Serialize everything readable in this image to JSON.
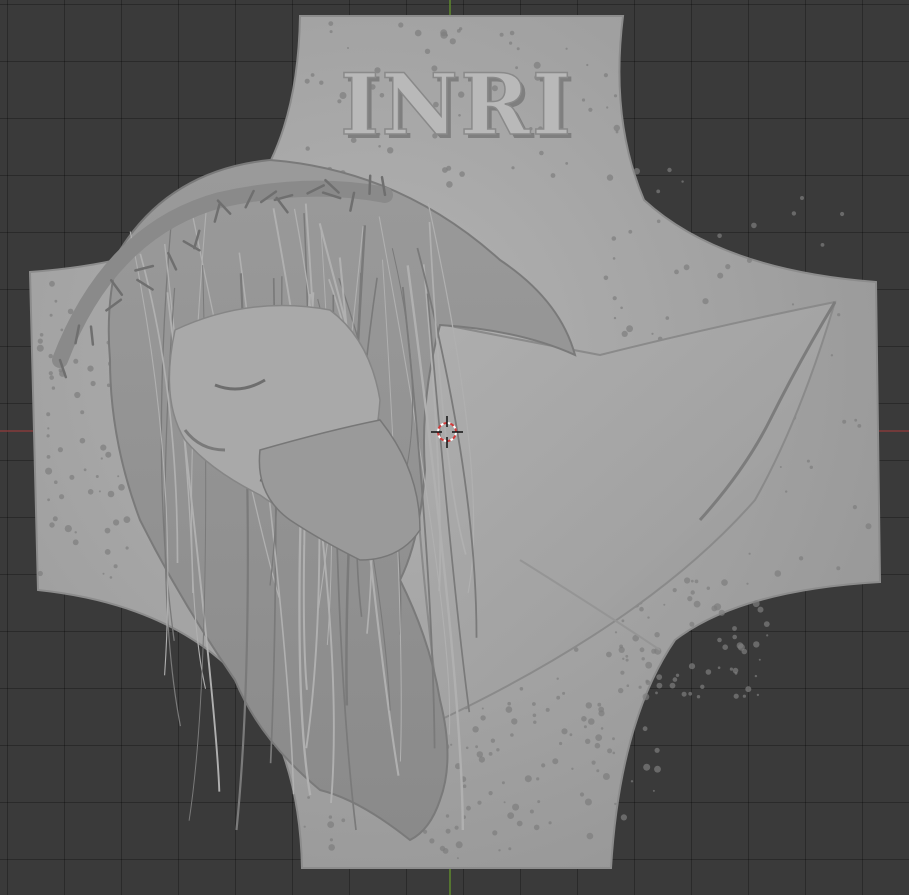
{
  "viewport": {
    "background_color": "#3a3a3a",
    "grid_color": "#2d2d2d",
    "axis_y_color": "#5f8a2e",
    "axis_x_color": "#8a3a3a"
  },
  "model": {
    "inscription": "INRI",
    "material_color": "#a7a7a7"
  },
  "cursor": {
    "icon": "3d-cursor-icon",
    "colors": [
      "#d23a3a",
      "#ffffff"
    ]
  }
}
